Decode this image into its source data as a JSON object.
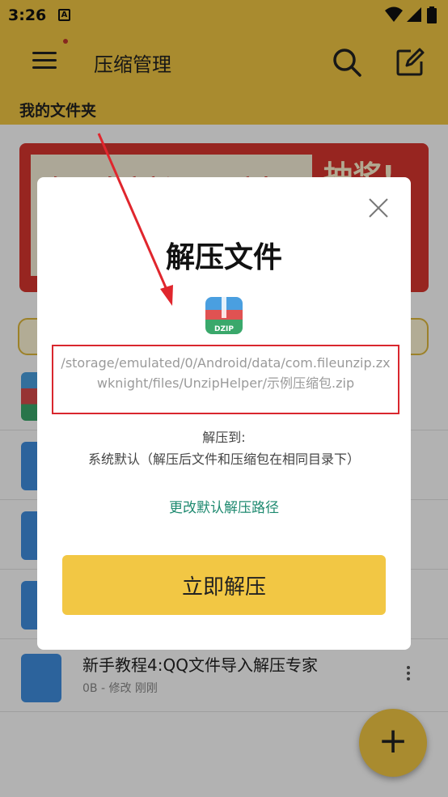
{
  "status_bar": {
    "time": "3:26",
    "notification_icon": "A"
  },
  "toolbar": {
    "title": "压缩管理",
    "menu_icon": "menu-icon",
    "search_icon": "search-icon",
    "edit_icon": "edit-icon"
  },
  "section": {
    "title": "我的文件夹"
  },
  "banner": {
    "text": "解压专家新DZIP商标",
    "badge": "抽奖!"
  },
  "files": [
    {
      "name": "新手教程4:QQ文件导入解压专家",
      "meta": "0B - 修改 刚刚"
    }
  ],
  "dialog": {
    "title": "解压文件",
    "file_path": "/storage/emulated/0/Android/data/com.fileunzip.zxwknight/files/UnzipHelper/示例压缩包.zip",
    "zip_icon_label": "DZIP",
    "extract_to_label": "解压到:",
    "extract_to_value": "系统默认（解压后文件和压缩包在相同目录下）",
    "change_path_link": "更改默认解压路径",
    "extract_button": "立即解压"
  },
  "fab": {
    "label": "+"
  },
  "colors": {
    "accent": "#f2c744",
    "link": "#1f8a70",
    "highlight": "#d9272e"
  }
}
